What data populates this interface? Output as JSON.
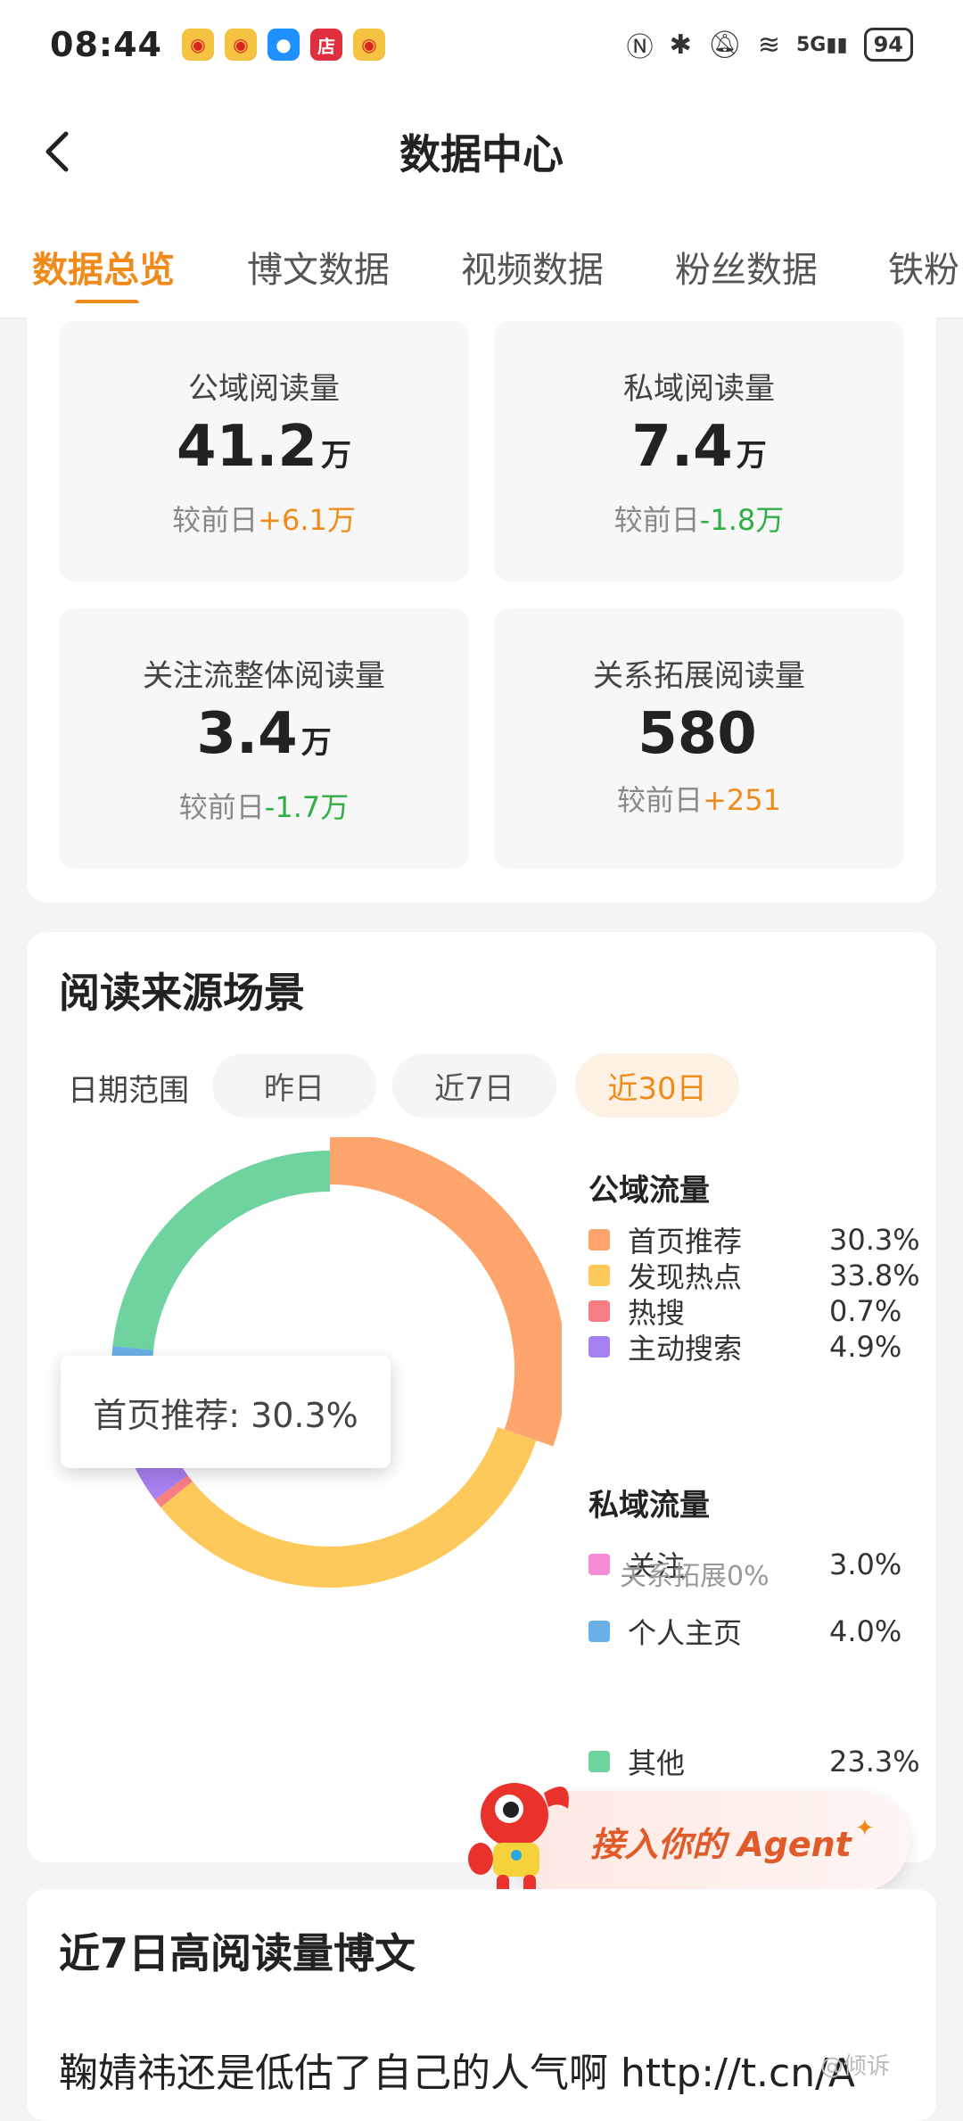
{
  "status_bar": {
    "time": "08:44",
    "notification_icons": [
      "weibo-icon",
      "weibo-icon",
      "chat-icon",
      "shop-icon",
      "weibo-icon"
    ],
    "shop_glyph": "店",
    "network": "5G",
    "battery": "94"
  },
  "header": {
    "title": "数据中心"
  },
  "tabs": [
    {
      "label": "数据总览",
      "active": true
    },
    {
      "label": "博文数据"
    },
    {
      "label": "视频数据"
    },
    {
      "label": "粉丝数据"
    },
    {
      "label": "铁粉"
    }
  ],
  "stats": [
    {
      "label": "公域阅读量",
      "value": "41.2",
      "unit": "万",
      "diff_prefix": "较前日",
      "diff": "+6.1万",
      "trend": "up"
    },
    {
      "label": "私域阅读量",
      "value": "7.4",
      "unit": "万",
      "diff_prefix": "较前日",
      "diff": "-1.8万",
      "trend": "down"
    },
    {
      "label": "关注流整体阅读量",
      "value": "3.4",
      "unit": "万",
      "diff_prefix": "较前日",
      "diff": "-1.7万",
      "trend": "down"
    },
    {
      "label": "关系拓展阅读量",
      "value": "580",
      "unit": "",
      "diff_prefix": "较前日",
      "diff": "+251",
      "trend": "up"
    }
  ],
  "source": {
    "title": "阅读来源场景",
    "range_label": "日期范围",
    "ranges": [
      {
        "label": "昨日"
      },
      {
        "label": "近7日"
      },
      {
        "label": "近30日",
        "active": true
      }
    ],
    "tooltip": "首页推荐: 30.3%",
    "public_group": "公域流量",
    "private_group": "私域流量",
    "private_sub": "关系拓展0%",
    "colors": {
      "首页推荐": "#fda56c",
      "发现热点": "#fdc95a",
      "热搜": "#f77f84",
      "主动搜索": "#a880f0",
      "关注": "#f58cd8",
      "个人主页": "#6ab0e6",
      "其他": "#6fd3a0"
    }
  },
  "chart_data": {
    "type": "pie",
    "style": "donut",
    "categories": [
      "首页推荐",
      "发现热点",
      "热搜",
      "主动搜索",
      "关注",
      "个人主页",
      "其他"
    ],
    "values": [
      30.3,
      33.8,
      0.7,
      4.9,
      3.0,
      4.0,
      23.3
    ],
    "value_labels": [
      "30.3%",
      "33.8%",
      "0.7%",
      "4.9%",
      "3.0%",
      "4.0%",
      "23.3%"
    ],
    "groups": {
      "公域流量": [
        "首页推荐",
        "发现热点",
        "热搜",
        "主动搜索"
      ],
      "私域流量": [
        "关注",
        "个人主页"
      ],
      "": [
        "其他"
      ]
    },
    "highlighted": "首页推荐"
  },
  "agent_banner": {
    "label": "接入你的 Agent"
  },
  "posts": {
    "title": "近7日高阅读量博文",
    "first_post": "鞠婧祎还是低估了自己的人气啊 http://t.cn/A"
  },
  "watermark": "@倾诉"
}
